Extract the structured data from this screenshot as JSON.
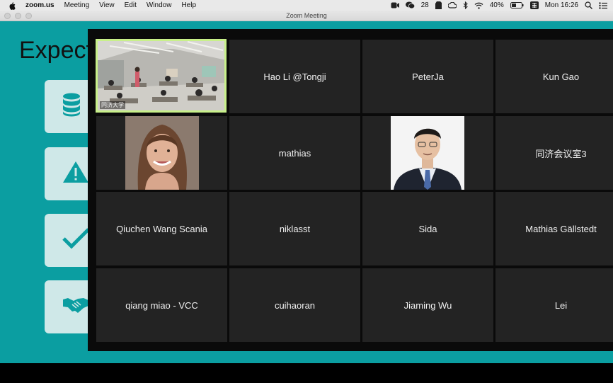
{
  "menubar": {
    "app_name": "zoom.us",
    "items": [
      "Meeting",
      "View",
      "Edit",
      "Window",
      "Help"
    ],
    "wechat_count": "28",
    "battery": "40%",
    "clock": "Mon 16:26"
  },
  "window": {
    "title": "Zoom Meeting"
  },
  "slide": {
    "title": "Expect"
  },
  "gallery": {
    "active_speaker_color": "#c8f08a",
    "tiles": [
      {
        "name": "同济大学",
        "kind": "video-room"
      },
      {
        "name": "Hao Li @Tongji",
        "kind": "name"
      },
      {
        "name": "PeterJa",
        "kind": "name"
      },
      {
        "name": "Kun Gao",
        "kind": "name"
      },
      {
        "name": "",
        "kind": "photo-woman"
      },
      {
        "name": "mathias",
        "kind": "name"
      },
      {
        "name": "",
        "kind": "photo-man"
      },
      {
        "name": "同济会议室3",
        "kind": "name"
      },
      {
        "name": "Qiuchen Wang Scania",
        "kind": "name"
      },
      {
        "name": "niklasst",
        "kind": "name"
      },
      {
        "name": "Sida",
        "kind": "name"
      },
      {
        "name": "Mathias Gällstedt",
        "kind": "name"
      },
      {
        "name": "qiang miao - VCC",
        "kind": "name"
      },
      {
        "name": "cuihaoran",
        "kind": "name"
      },
      {
        "name": "Jiaming Wu",
        "kind": "name"
      },
      {
        "name": "Lei",
        "kind": "name"
      }
    ]
  }
}
